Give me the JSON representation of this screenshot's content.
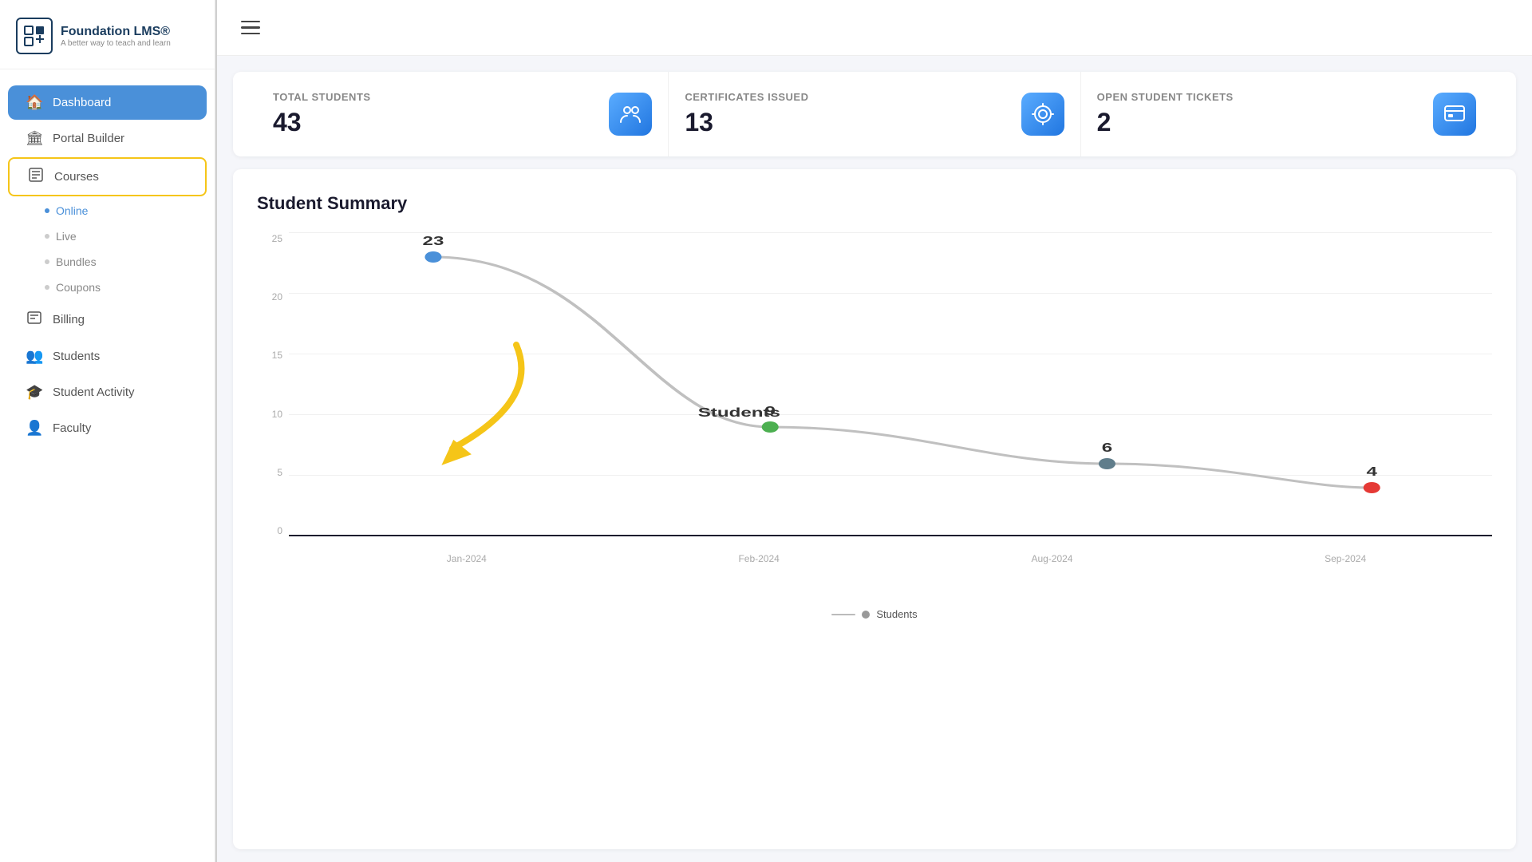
{
  "sidebar": {
    "logo": {
      "title": "Foundation LMS®",
      "subtitle": "A better way to teach and learn",
      "icon": "F"
    },
    "nav": [
      {
        "id": "dashboard",
        "label": "Dashboard",
        "icon": "🏠",
        "active": true
      },
      {
        "id": "portal-builder",
        "label": "Portal Builder",
        "icon": "🏛",
        "active": false
      },
      {
        "id": "courses",
        "label": "Courses",
        "icon": "📋",
        "active": false,
        "highlighted": true
      },
      {
        "id": "billing",
        "label": "Billing",
        "icon": "📄",
        "active": false
      },
      {
        "id": "students",
        "label": "Students",
        "icon": "👥",
        "active": false
      },
      {
        "id": "student-activity",
        "label": "Student Activity",
        "icon": "🎓",
        "active": false
      },
      {
        "id": "faculty",
        "label": "Faculty",
        "icon": "👤",
        "active": false
      }
    ],
    "sub_nav": [
      {
        "id": "online",
        "label": "Online",
        "active": true
      },
      {
        "id": "live",
        "label": "Live",
        "active": false
      },
      {
        "id": "bundles",
        "label": "Bundles",
        "active": false
      },
      {
        "id": "coupons",
        "label": "Coupons",
        "active": false
      }
    ]
  },
  "header": {
    "menu_icon": "☰"
  },
  "stats": [
    {
      "id": "total-students",
      "label": "TOTAL STUDENTS",
      "value": "43",
      "icon": "👥"
    },
    {
      "id": "certificates-issued",
      "label": "CERTIFICATES ISSUED",
      "value": "13",
      "icon": "⚙"
    },
    {
      "id": "open-student-tickets",
      "label": "OPEN STUDENT TICKETS",
      "value": "2",
      "icon": "🖥"
    }
  ],
  "chart": {
    "title": "Student Summary",
    "y_labels": [
      "0",
      "5",
      "10",
      "15",
      "20",
      "25"
    ],
    "x_labels": [
      "Jan-2024",
      "Feb-2024",
      "Aug-2024",
      "Sep-2024"
    ],
    "data_points": [
      {
        "x_pct": 12,
        "y_pct": 92,
        "value": "23",
        "color": "#4a90d9"
      },
      {
        "x_pct": 40,
        "y_pct": 36,
        "value": "9",
        "color": "#4caf50"
      },
      {
        "x_pct": 68,
        "y_pct": 24,
        "value": "6",
        "color": "#607d8b"
      },
      {
        "x_pct": 90,
        "y_pct": 16,
        "value": "4",
        "color": "#e53935"
      }
    ],
    "legend": "Students",
    "series_label": "Students"
  }
}
